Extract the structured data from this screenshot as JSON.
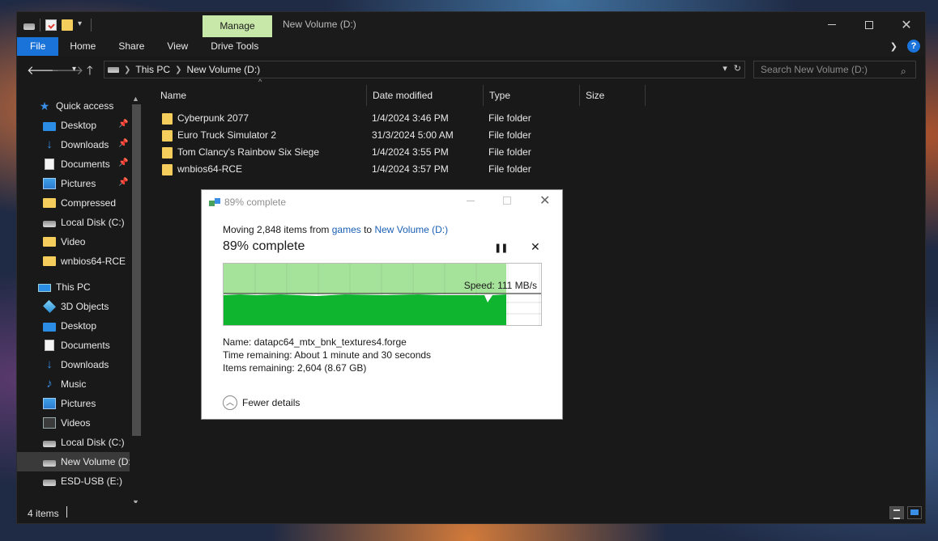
{
  "titlebar": {
    "manage_tab": "Manage",
    "title": "New Volume (D:)"
  },
  "ribbon": {
    "tabs": [
      "File",
      "Home",
      "Share",
      "View",
      "Drive Tools"
    ],
    "help": "?"
  },
  "address": {
    "crumbs": [
      "This PC",
      "New Volume (D:)"
    ],
    "search_placeholder": "Search New Volume (D:)"
  },
  "sidebar": {
    "quick_access": "Quick access",
    "quick_items": [
      {
        "label": "Desktop",
        "icon": "desktop-icon",
        "pinned": true
      },
      {
        "label": "Downloads",
        "icon": "download-icon",
        "pinned": true
      },
      {
        "label": "Documents",
        "icon": "document-icon",
        "pinned": true
      },
      {
        "label": "Pictures",
        "icon": "pictures-icon",
        "pinned": true
      },
      {
        "label": "Compressed",
        "icon": "folder-icon",
        "pinned": false
      },
      {
        "label": "Local Disk (C:)",
        "icon": "drive-icon",
        "pinned": false
      },
      {
        "label": "Video",
        "icon": "folder-icon",
        "pinned": false
      },
      {
        "label": "wnbios64-RCE",
        "icon": "folder-icon",
        "pinned": false
      }
    ],
    "this_pc": "This PC",
    "pc_items": [
      {
        "label": "3D Objects",
        "icon": "3d-objects-icon"
      },
      {
        "label": "Desktop",
        "icon": "desktop-icon"
      },
      {
        "label": "Documents",
        "icon": "document-icon"
      },
      {
        "label": "Downloads",
        "icon": "download-icon"
      },
      {
        "label": "Music",
        "icon": "music-icon"
      },
      {
        "label": "Pictures",
        "icon": "pictures-icon"
      },
      {
        "label": "Videos",
        "icon": "video-icon"
      },
      {
        "label": "Local Disk (C:)",
        "icon": "drive-icon"
      },
      {
        "label": "New Volume (D:",
        "icon": "drive-icon",
        "selected": true
      },
      {
        "label": "ESD-USB (E:)",
        "icon": "drive-icon"
      }
    ]
  },
  "columns": {
    "name": "Name",
    "date": "Date modified",
    "type": "Type",
    "size": "Size"
  },
  "files": [
    {
      "name": "Cyberpunk 2077",
      "date": "1/4/2024 3:46 PM",
      "type": "File folder"
    },
    {
      "name": "Euro Truck Simulator 2",
      "date": "31/3/2024 5:00 AM",
      "type": "File folder"
    },
    {
      "name": "Tom Clancy's Rainbow Six Siege",
      "date": "1/4/2024 3:55 PM",
      "type": "File folder"
    },
    {
      "name": "wnbios64-RCE",
      "date": "1/4/2024 3:57 PM",
      "type": "File folder"
    }
  ],
  "status": {
    "count": "4 items"
  },
  "dialog": {
    "title": "89% complete",
    "moving_prefix": "Moving 2,848 items from ",
    "source": "games",
    "to_word": " to ",
    "destination": "New Volume (D:)",
    "percent_text": "89% complete",
    "progress": 0.89,
    "speed": "Speed: 111 MB/s",
    "name_line": "Name:  datapc64_mtx_bnk_textures4.forge",
    "time_line": "Time remaining:  About 1 minute and 30 seconds",
    "items_line": "Items remaining:  2,604 (8.67 GB)",
    "fewer_details": "Fewer details"
  },
  "colors": {
    "accent": "#1a73d9",
    "manage_tab": "#c7e8a8",
    "progress_light": "#a6e39a",
    "progress_dark": "#0fb52e",
    "folder": "#f4cd5c"
  }
}
